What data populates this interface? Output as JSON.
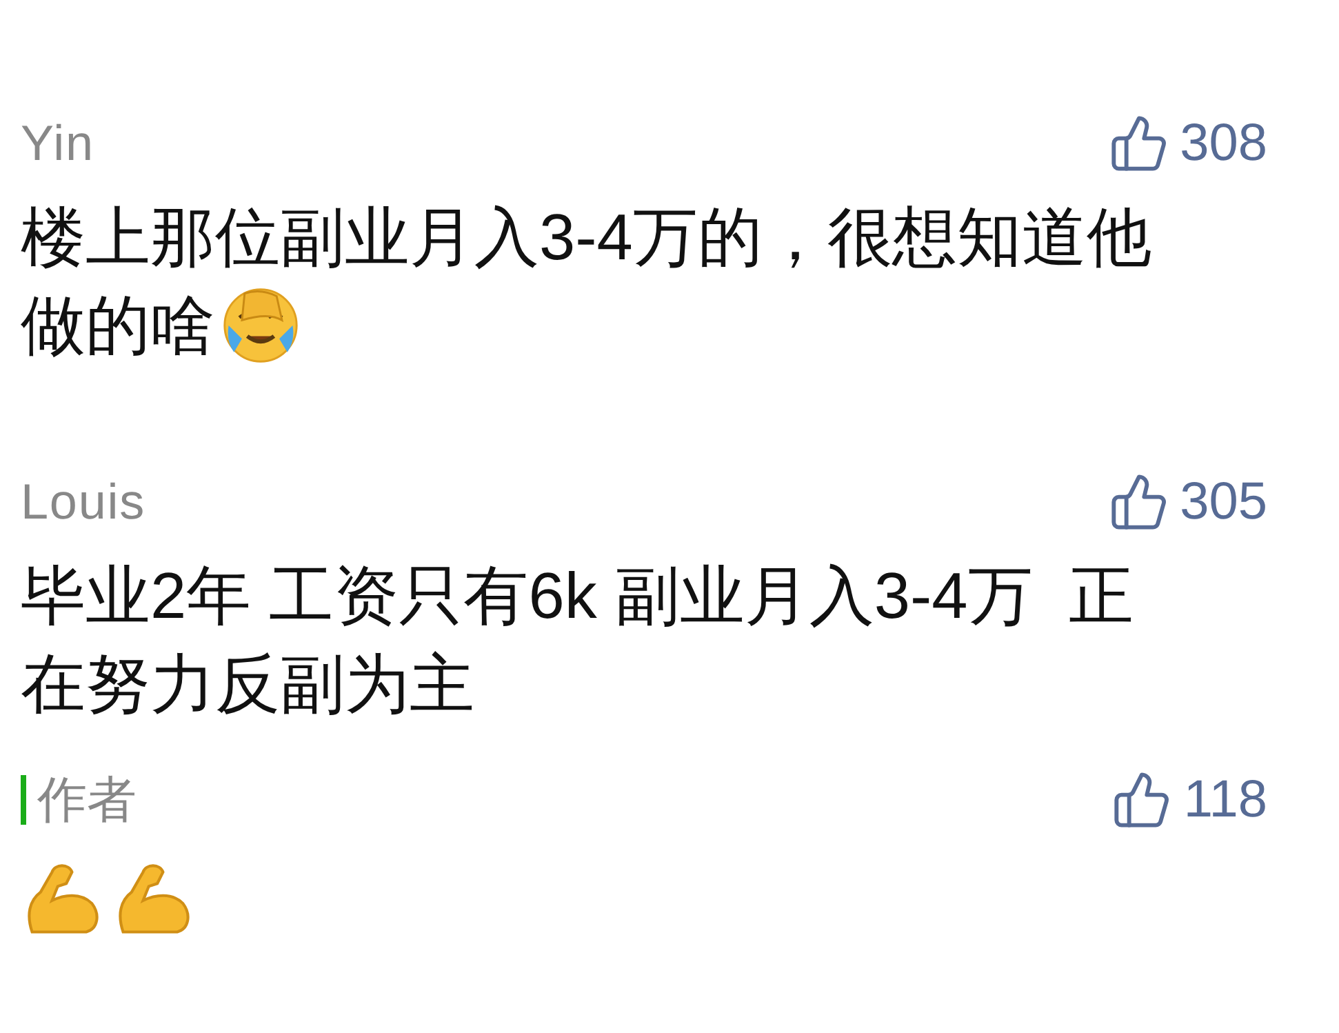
{
  "comments": [
    {
      "user": "Yin",
      "likes": "308",
      "lines": [
        "楼上那位副业月入3-4万的，很想知道他",
        "做的啥"
      ],
      "emojis": [
        {
          "kind": "facepalm-crying"
        }
      ]
    },
    {
      "user": "Louis",
      "likes": "305",
      "lines": [
        "毕业2年 工资只有6k 副业月入3-4万  正",
        "在努力反副为主"
      ]
    }
  ],
  "author_reply": {
    "badge": "作者",
    "likes": "118",
    "emojis": [
      {
        "kind": "flexed-arm"
      },
      {
        "kind": "flexed-arm"
      }
    ]
  }
}
